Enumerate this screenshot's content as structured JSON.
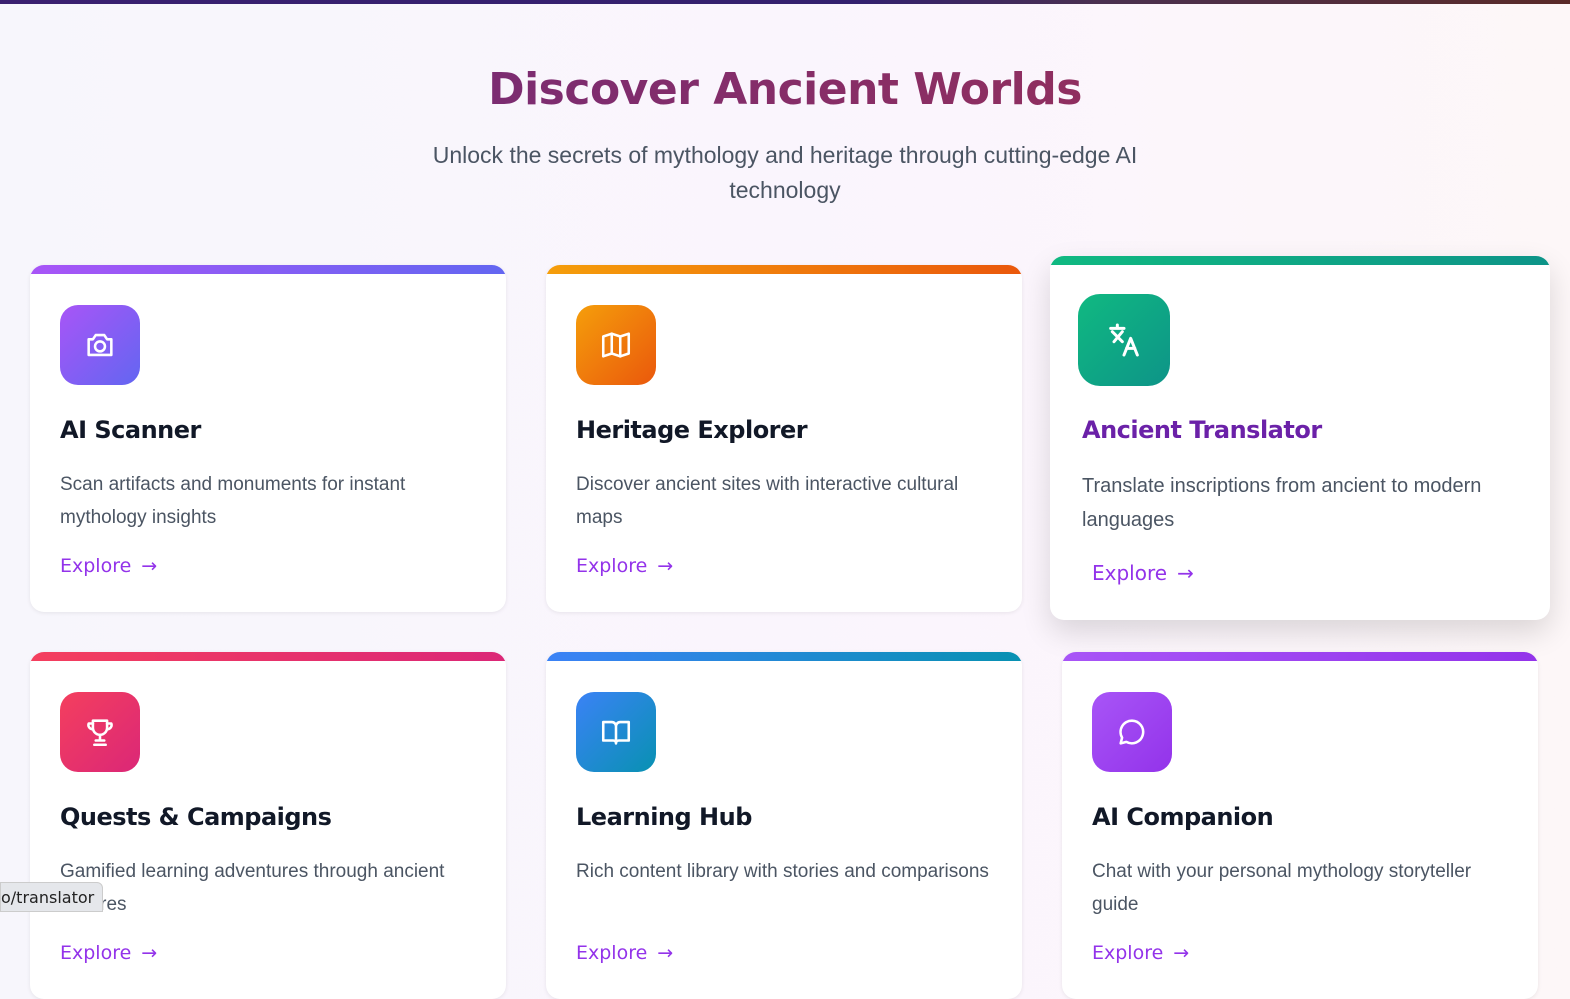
{
  "hero": {
    "title": "Discover Ancient Worlds",
    "subtitle": "Unlock the secrets of mythology and heritage through cutting-edge AI technology"
  },
  "cards": [
    {
      "title": "AI Scanner",
      "description": "Scan artifacts and monuments for instant mythology insights",
      "link": "Explore",
      "icon": "camera-icon",
      "colors": [
        "#a855f7",
        "#6366f1"
      ]
    },
    {
      "title": "Heritage Explorer",
      "description": "Discover ancient sites with interactive cultural maps",
      "link": "Explore",
      "icon": "map-icon",
      "colors": [
        "#f59e0b",
        "#ea580c"
      ]
    },
    {
      "title": "Ancient Translator",
      "description": "Translate inscriptions from ancient to modern languages",
      "link": "Explore",
      "icon": "translate-icon",
      "colors": [
        "#10b981",
        "#0d9488"
      ]
    },
    {
      "title": "Quests & Campaigns",
      "description": "Gamified learning adventures through ancient cultures",
      "link": "Explore",
      "icon": "trophy-icon",
      "colors": [
        "#f43f5e",
        "#db2777"
      ]
    },
    {
      "title": "Learning Hub",
      "description": "Rich content library with stories and comparisons",
      "link": "Explore",
      "icon": "book-icon",
      "colors": [
        "#3b82f6",
        "#0891b2"
      ]
    },
    {
      "title": "AI Companion",
      "description": "Chat with your personal mythology storyteller guide",
      "link": "Explore",
      "icon": "chat-icon",
      "colors": [
        "#a855f7",
        "#9333ea"
      ]
    }
  ],
  "status_tooltip": "o/translator"
}
